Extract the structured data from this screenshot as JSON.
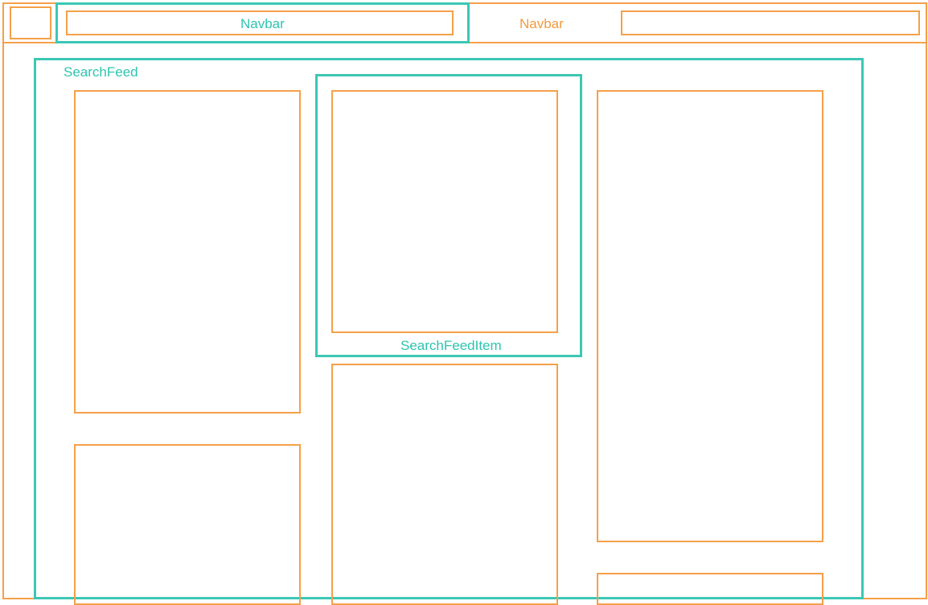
{
  "labels": {
    "navbar_inner": "Navbar",
    "navbar_outer": "Navbar",
    "search_feed": "SearchFeed",
    "search_feed_item": "SearchFeedItem"
  },
  "colors": {
    "orange": "#f5a04a",
    "teal": "#3cc7b4"
  }
}
